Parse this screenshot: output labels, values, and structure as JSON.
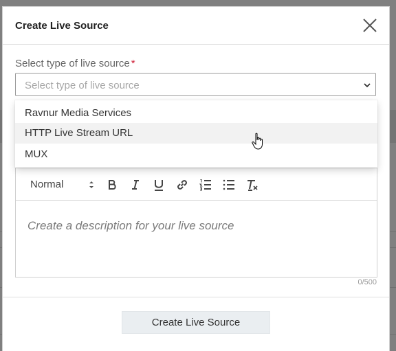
{
  "modal": {
    "title": "Create Live Source",
    "submit_label": "Create Live Source"
  },
  "source_type": {
    "label": "Select type of live source",
    "required_mark": "*",
    "placeholder": "Select type of live source",
    "options": [
      "Ravnur Media Services",
      "HTTP Live Stream URL",
      "MUX"
    ],
    "hovered_option": "HTTP Live Stream URL"
  },
  "editor": {
    "format_select": "Normal",
    "toolbar_icons": [
      "bold-icon",
      "italic-icon",
      "underline-icon",
      "link-icon",
      "ordered-list-icon",
      "bullet-list-icon",
      "clear-format-icon"
    ],
    "placeholder": "Create a description for your live source",
    "counter": "0/500"
  },
  "colors": {
    "required": "#d0243b",
    "overlay": "#808080",
    "submit_bg": "#eaeef1"
  }
}
